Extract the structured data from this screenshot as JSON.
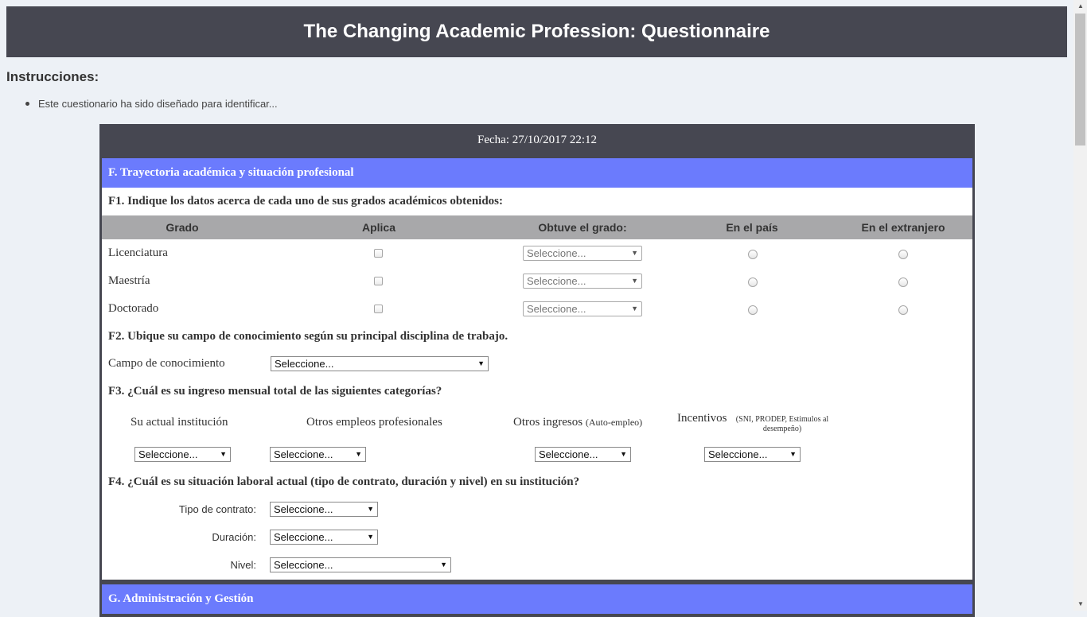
{
  "page": {
    "title": "The Changing Academic Profession: Questionnaire",
    "instructions_title": "Instrucciones:",
    "instructions": [
      "Este cuestionario ha sido diseñado para identificar..."
    ],
    "fecha": "Fecha: 27/10/2017 22:12"
  },
  "sectionF": {
    "title": "F. Trayectoria académica y situación profesional",
    "f1": {
      "question": "F1. Indique los datos acerca de cada uno de sus grados académicos obtenidos:",
      "headers": [
        "Grado",
        "Aplica",
        "Obtuve el grado:",
        "En el país",
        "En el extranjero"
      ],
      "rows": [
        {
          "grado": "Licenciatura",
          "select": "Seleccione..."
        },
        {
          "grado": "Maestría",
          "select": "Seleccione..."
        },
        {
          "grado": "Doctorado",
          "select": "Seleccione..."
        }
      ]
    },
    "f2": {
      "question": "F2. Ubique su campo de conocimiento según su principal disciplina de trabajo.",
      "label": "Campo de conocimiento",
      "select": "Seleccione..."
    },
    "f3": {
      "question": "F3. ¿Cuál es su ingreso mensual total de las siguientes categorías?",
      "col1": "Su actual institución",
      "col2": "Otros empleos profesionales",
      "col3": "Otros ingresos",
      "col3_note": "(Auto-empleo)",
      "col4": "Incentivos",
      "col4_note": "(SNI, PRODEP, Estimulos al desempeño)",
      "select": "Seleccione..."
    },
    "f4": {
      "question": "F4. ¿Cuál es su situación laboral actual (tipo de contrato, duración y nivel) en su institución?",
      "fields": [
        {
          "label": "Tipo de contrato:",
          "select": "Seleccione..."
        },
        {
          "label": "Duración:",
          "select": "Seleccione..."
        },
        {
          "label": "Nivel:",
          "select": "Seleccione..."
        }
      ]
    }
  },
  "sectionG": {
    "title": "G. Administración y Gestión"
  },
  "colors": {
    "header_bg": "#464751",
    "section_bg": "#6b7bfd",
    "table_header_bg": "#a8a8aa",
    "page_bg": "#edf1f6"
  }
}
